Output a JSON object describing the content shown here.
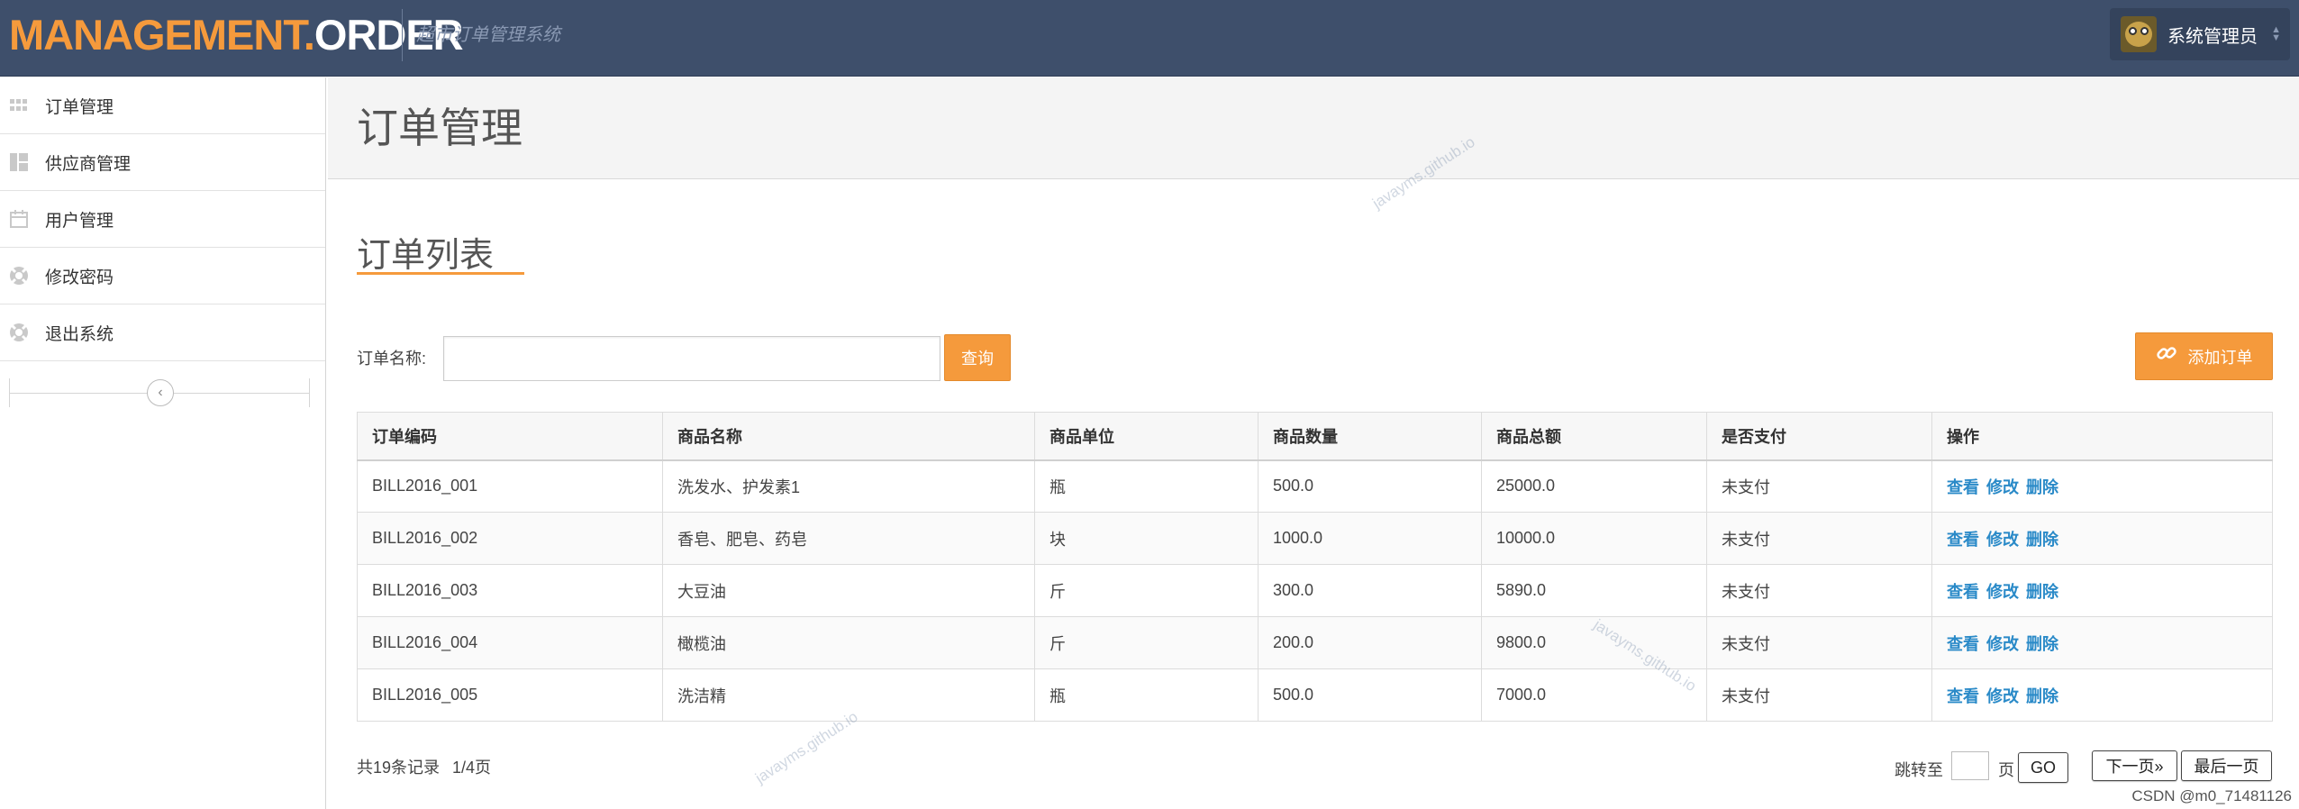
{
  "header": {
    "brand_part1": "MANAGEMENT.",
    "brand_part2": "ORDER",
    "subtitle": "超市订单管理系统",
    "user_name": "系统管理员"
  },
  "sidebar": {
    "items": [
      {
        "label": "订单管理",
        "icon": "grid-icon"
      },
      {
        "label": "供应商管理",
        "icon": "layout-icon"
      },
      {
        "label": "用户管理",
        "icon": "calendar-icon"
      },
      {
        "label": "修改密码",
        "icon": "lifebuoy-icon"
      },
      {
        "label": "退出系统",
        "icon": "lifebuoy-icon"
      }
    ]
  },
  "page": {
    "title": "订单管理",
    "section_title": "订单列表"
  },
  "search": {
    "label": "订单名称:",
    "value": "",
    "button": "查询"
  },
  "add_button": "添加订单",
  "table": {
    "columns": [
      "订单编码",
      "商品名称",
      "商品单位",
      "商品数量",
      "商品总额",
      "是否支付",
      "操作"
    ],
    "rows": [
      [
        "BILL2016_001",
        "洗发水、护发素1",
        "瓶",
        "500.0",
        "25000.0",
        "未支付"
      ],
      [
        "BILL2016_002",
        "香皂、肥皂、药皂",
        "块",
        "1000.0",
        "10000.0",
        "未支付"
      ],
      [
        "BILL2016_003",
        "大豆油",
        "斤",
        "300.0",
        "5890.0",
        "未支付"
      ],
      [
        "BILL2016_004",
        "橄榄油",
        "斤",
        "200.0",
        "9800.0",
        "未支付"
      ],
      [
        "BILL2016_005",
        "洗洁精",
        "瓶",
        "500.0",
        "7000.0",
        "未支付"
      ]
    ],
    "actions": [
      "查看",
      "修改",
      "删除"
    ]
  },
  "footer": {
    "total_records": "共19条记录",
    "page_info": "1/4页",
    "jump_label": "跳转至",
    "jump_value": "",
    "page_unit": "页",
    "go_button": "GO",
    "next_button": "下一页»",
    "last_button": "最后一页"
  },
  "watermark": "javayms.github.io",
  "csdn_credit": "CSDN @m0_71481126",
  "colors": {
    "header_bg": "#3e4f6b",
    "accent_orange": "#f59a3c",
    "link_blue": "#2a8ac8"
  }
}
